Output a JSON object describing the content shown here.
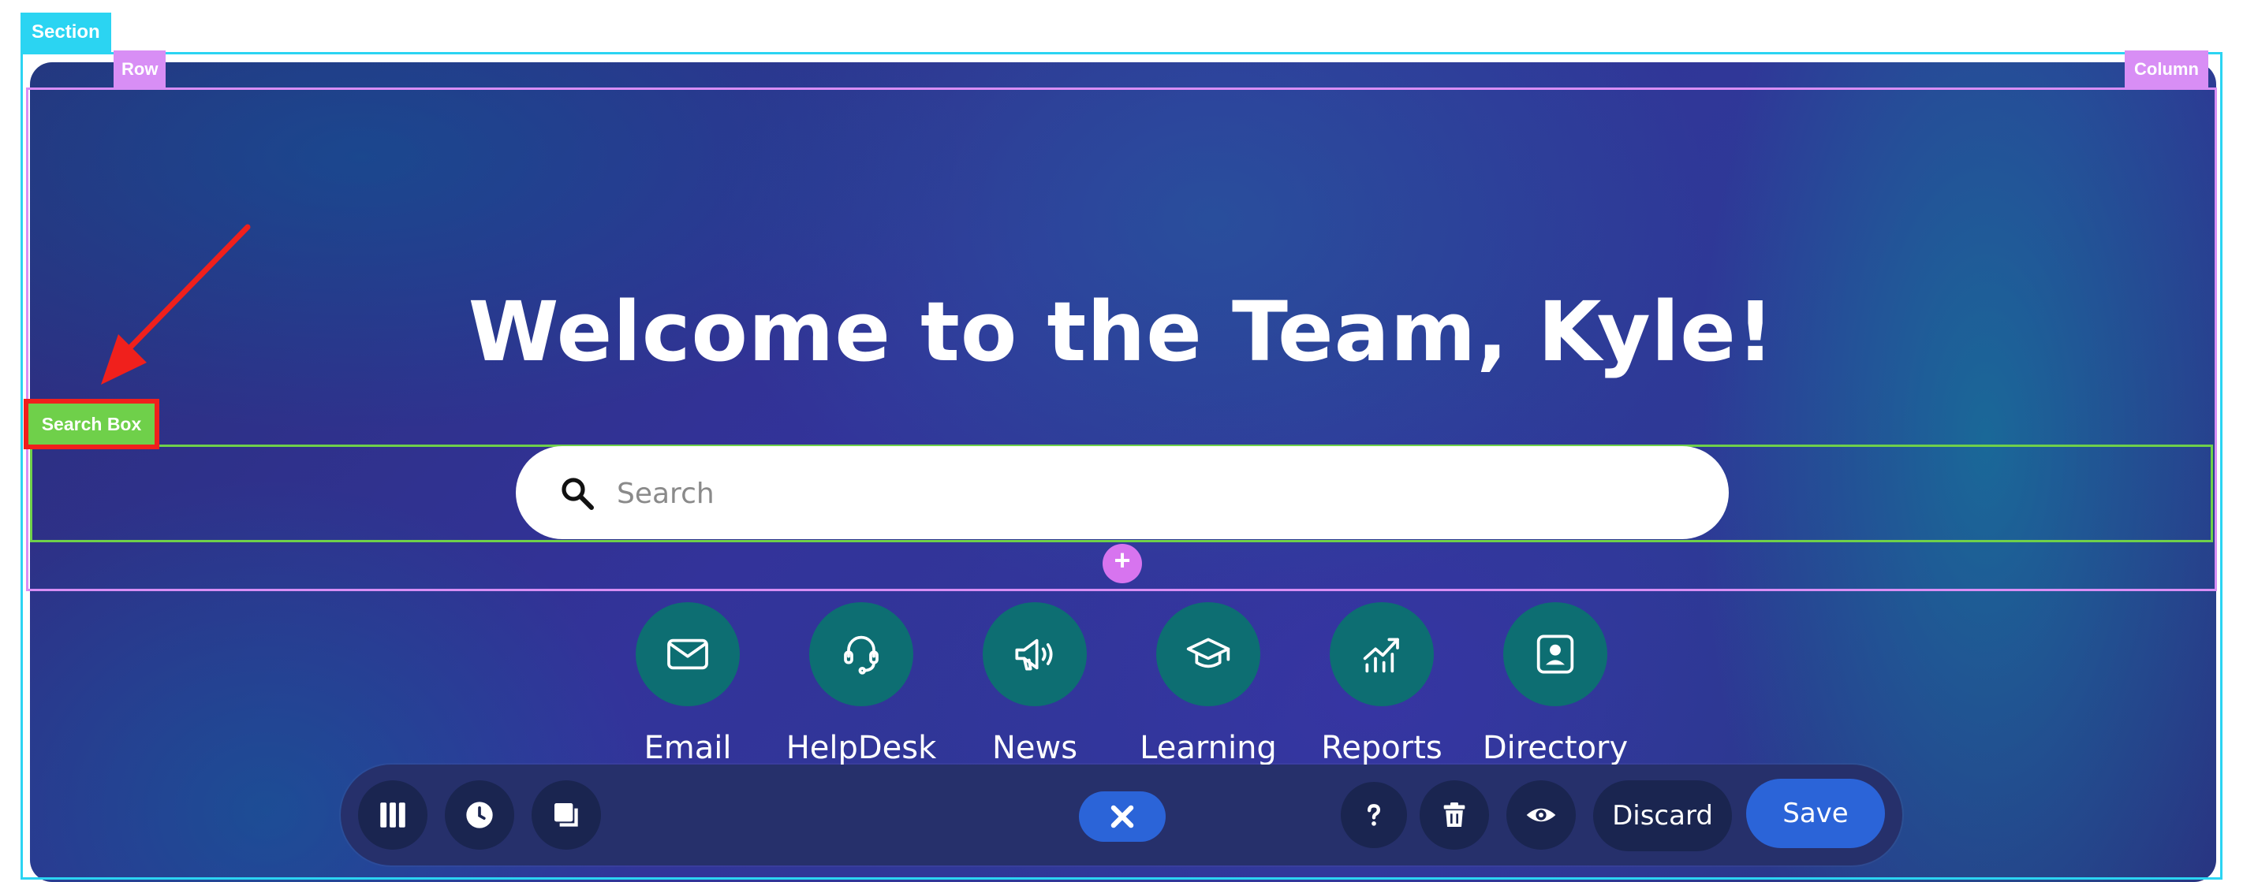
{
  "editor": {
    "section_tag": "Section",
    "row_tag": "Row",
    "column_tag": "Column",
    "search_box_tag": "Search Box",
    "add_button_glyph": "+"
  },
  "hero": {
    "title": "Welcome to the Team, Kyle!",
    "search": {
      "placeholder": "Search",
      "value": ""
    }
  },
  "quick_links": [
    {
      "label": "Email",
      "icon": "envelope-icon"
    },
    {
      "label": "HelpDesk",
      "icon": "headset-icon"
    },
    {
      "label": "News",
      "icon": "megaphone-icon"
    },
    {
      "label": "Learning",
      "icon": "graduation-cap-icon"
    },
    {
      "label": "Reports",
      "icon": "chart-trend-icon"
    },
    {
      "label": "Directory",
      "icon": "contact-card-icon"
    }
  ],
  "toolbar": {
    "left_icons": [
      "columns-icon",
      "clock-icon",
      "copy-icon"
    ],
    "close_icon": "close-icon",
    "right_icons": [
      "help-icon",
      "trash-icon",
      "eye-icon"
    ],
    "discard_label": "Discard",
    "save_label": "Save"
  },
  "colors": {
    "section_outline": "#2bd4f2",
    "row_outline": "#d88ef5",
    "search_outline": "#6fd04a",
    "annotation_red": "#f0201c",
    "icon_circle": "#0d6e72",
    "toolbar_bg": "#26306b",
    "primary_button": "#2b64d8"
  }
}
